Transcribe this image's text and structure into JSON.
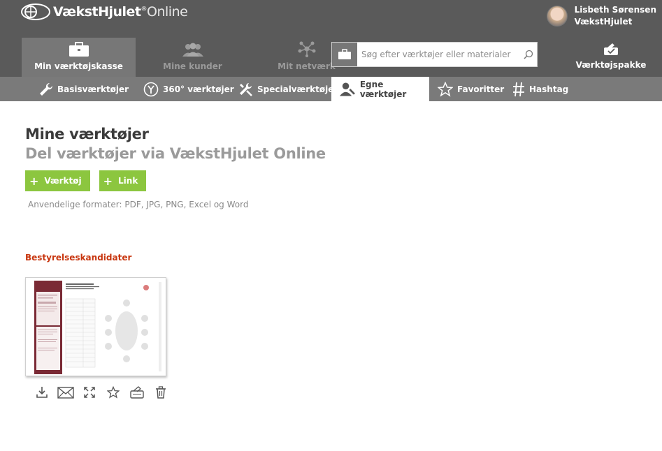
{
  "header": {
    "logo_brand": "VækstHjulet",
    "logo_reg": "®",
    "logo_suffix": "Online",
    "user_name": "Lisbeth Sørensen",
    "user_org": "VækstHjulet"
  },
  "main_nav": [
    {
      "label": "Min værktøjskasse",
      "icon": "toolbox-icon",
      "active": true
    },
    {
      "label": "Mine kunder",
      "icon": "customers-icon",
      "active": false
    },
    {
      "label": "Mit netværk",
      "icon": "network-icon",
      "active": false
    }
  ],
  "search": {
    "placeholder": "Søg efter værktøjer eller materialer"
  },
  "toolkit": {
    "label": "Værktøjspakke"
  },
  "sub_nav": [
    {
      "label": "Basisværktøjer",
      "icon": "wrench-icon",
      "active": false
    },
    {
      "label": "360° værktøjer",
      "icon": "360-icon",
      "active": false
    },
    {
      "label": "Specialværktøjer",
      "icon": "special-tools-icon",
      "active": false
    },
    {
      "label": "Egne værktøjer",
      "icon": "user-tool-icon",
      "active": true
    },
    {
      "label": "Favoritter",
      "icon": "star-icon",
      "active": false
    },
    {
      "label": "Hashtag",
      "icon": "hashtag-icon",
      "active": false
    }
  ],
  "page": {
    "title": "Mine værktøjer",
    "subtitle": "Del værktøjer via VækstHjulet Online",
    "add_tool_label": "Værktøj",
    "add_link_label": "Link",
    "formats_text": "Anvendelige formater: PDF, JPG, PNG, Excel og Word"
  },
  "tools": [
    {
      "title": "Bestyrelseskandidater",
      "actions": [
        "download-icon",
        "mail-icon",
        "expand-icon",
        "favorite-star-icon",
        "add-to-package-icon",
        "delete-icon"
      ]
    }
  ],
  "colors": {
    "topbar": "#5a5a5a",
    "subnav": "#7a7a7a",
    "accent_green": "#8cc63f",
    "section_red": "#c8360f",
    "thumb_dark_red": "#7a2a35"
  }
}
